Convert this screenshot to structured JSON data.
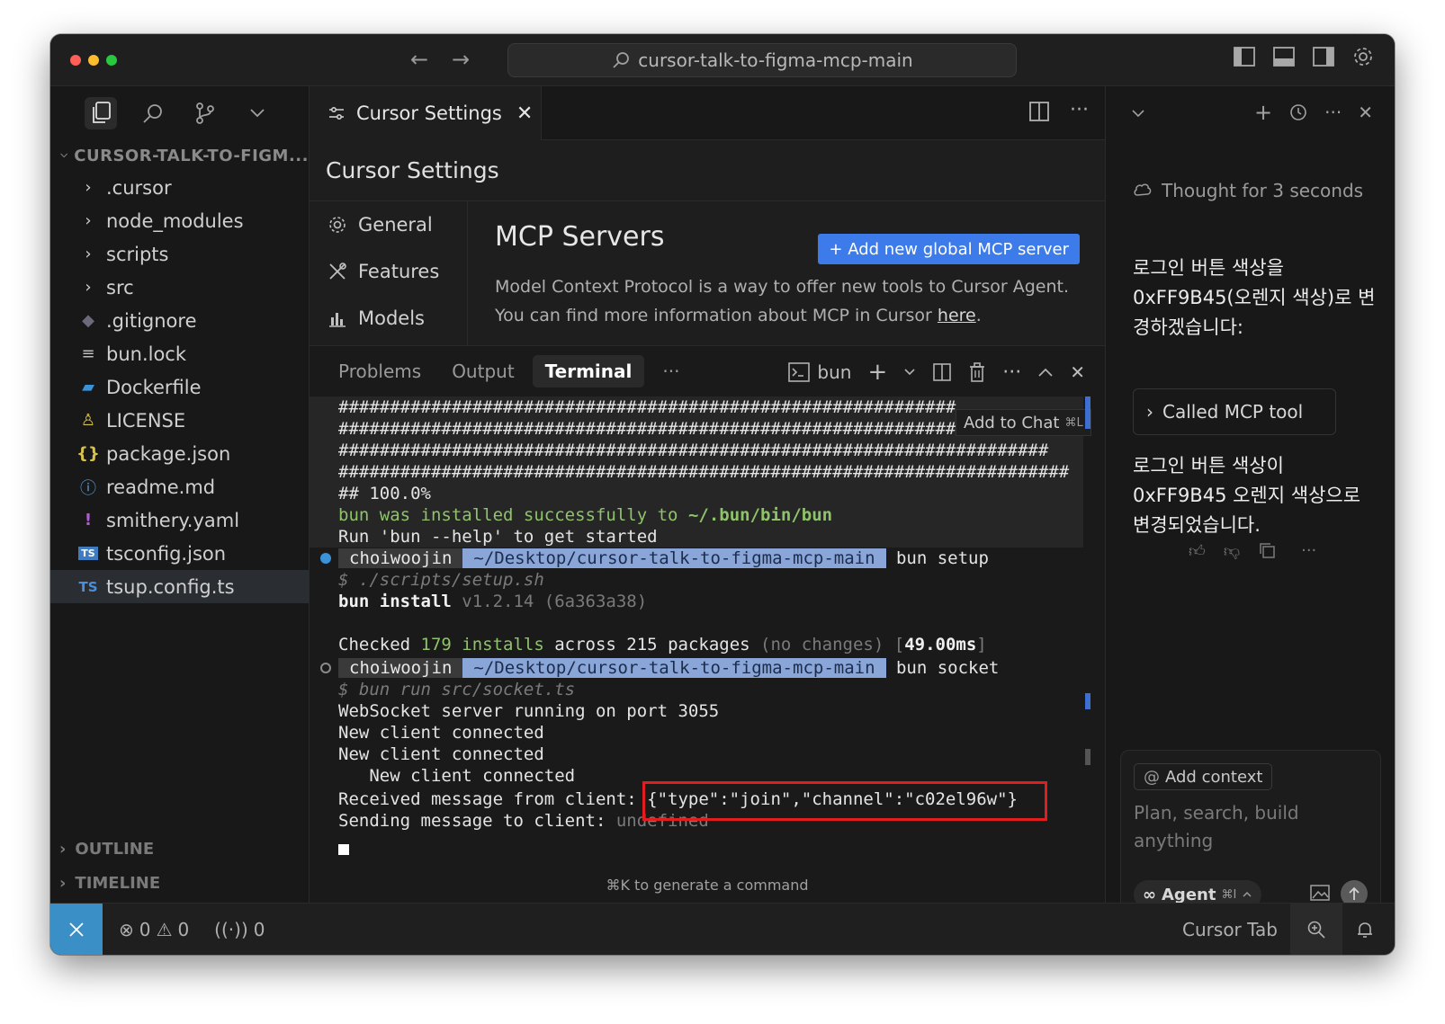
{
  "titlebar": {
    "search_text": "cursor-talk-to-figma-mcp-main"
  },
  "explorer": {
    "title": "CURSOR-TALK-TO-FIGM...",
    "items": [
      {
        "label": ".cursor",
        "icon": "chevron-right-icon"
      },
      {
        "label": "node_modules",
        "icon": "chevron-right-icon"
      },
      {
        "label": "scripts",
        "icon": "chevron-right-icon"
      },
      {
        "label": "src",
        "icon": "chevron-right-icon"
      },
      {
        "label": ".gitignore",
        "icon": "git-icon"
      },
      {
        "label": "bun.lock",
        "icon": "lines-icon"
      },
      {
        "label": "Dockerfile",
        "icon": "docker-icon"
      },
      {
        "label": "LICENSE",
        "icon": "license-icon"
      },
      {
        "label": "package.json",
        "icon": "braces-icon"
      },
      {
        "label": "readme.md",
        "icon": "info-icon"
      },
      {
        "label": "smithery.yaml",
        "icon": "exclamation-icon"
      },
      {
        "label": "tsconfig.json",
        "icon": "ts-config-icon"
      },
      {
        "label": "tsup.config.ts",
        "icon": "ts-icon"
      }
    ],
    "outline": "OUTLINE",
    "timeline": "TIMELINE"
  },
  "editor": {
    "tab_label": "Cursor Settings",
    "settings_title": "Cursor Settings",
    "nav": {
      "general": "General",
      "features": "Features",
      "models": "Models"
    },
    "mcp": {
      "title": "MCP Servers",
      "add_button": "+ Add new global MCP server",
      "desc_prefix": "Model Context Protocol is a way to offer new tools to Cursor Agent. You can find more information about MCP in Cursor ",
      "desc_link": "here",
      "desc_suffix": "."
    }
  },
  "panel": {
    "tabs": {
      "problems": "Problems",
      "output": "Output",
      "terminal": "Terminal",
      "more": "···"
    },
    "shell_name": "bun",
    "tooltip": {
      "label": "Add to Chat",
      "kbd": "⌘L"
    },
    "terminal": {
      "hash1": "############################################################",
      "hash2": "################################################################",
      "hash3": "#####################################################################",
      "hash4": "#######################################################################",
      "percent": "## 100.0%",
      "installed_a": "bun was installed successfully to ",
      "installed_b": "~/.bun/bin/bun",
      "help": "Run 'bun --help' to get started",
      "user": "choiwoojin",
      "path": "~/Desktop/cursor-talk-to-figma-mcp-main",
      "cmd1": "bun setup",
      "script1": "$ ./scripts/setup.sh",
      "install_a": "bun install",
      "install_b": " v1.2.14 (6a363a38)",
      "checked_a": "Checked ",
      "checked_b": "179",
      "checked_c": " installs",
      "checked_d": " across 215 packages ",
      "checked_e": "(no changes)",
      "checked_f": " [",
      "checked_g": "49.00ms",
      "checked_h": "]",
      "cmd2": "bun socket",
      "script2": "$ bun run src/socket.ts",
      "ws": "WebSocket server running on port 3055",
      "nc1": "New client connected",
      "nc2": "New client connected",
      "nc3": "   New client connected",
      "recv_a": "Received message from client: ",
      "recv_b": "{\"type\":\"join\",\"channel\":\"c02el96w\"}",
      "send_a": "Sending message to client: ",
      "send_b": "undefined"
    },
    "gen_hint": "⌘K to generate a command"
  },
  "chat": {
    "thought": "Thought for 3 seconds",
    "msg1": "로그인 버튼 색상을 0xFF9B45(오렌지 색상)로 변경하겠습니다:",
    "mcp_call": "Called MCP tool",
    "msg2": "로그인 버튼 색상이 0xFF9B45 오렌지 색상으로 변경되었습니다.",
    "add_context": "Add context",
    "placeholder": "Plan, search, build anything",
    "agent_label": "Agent",
    "agent_kbd": "⌘I"
  },
  "statusbar": {
    "errors": "0",
    "warnings": "0",
    "ports": "0",
    "cursor_tab": "Cursor Tab"
  },
  "colors": {
    "accent_blue": "#3c7be9",
    "highlight_red": "#e21d1d",
    "terminal_green": "#8fc36a",
    "remote_blue": "#3a8fc7"
  }
}
